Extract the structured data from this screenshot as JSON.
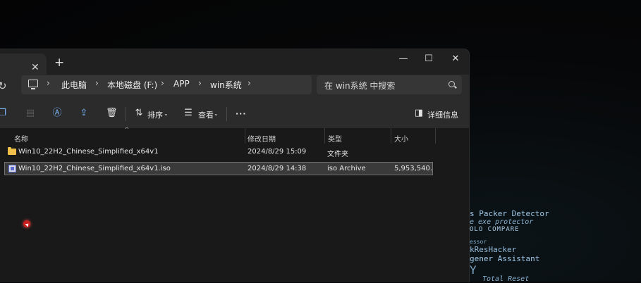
{
  "window": {
    "controls": {
      "minimize": "—",
      "maximize": "☐",
      "close": "✕"
    },
    "tab_close": "✕",
    "new_tab": "+"
  },
  "breadcrumb": [
    "此电脑",
    "本地磁盘 (F:)",
    "APP",
    "win系统"
  ],
  "search": {
    "placeholder": "在 win系统 中搜索"
  },
  "toolbar": {
    "sort_label": "排序",
    "view_label": "查看",
    "more_label": "···",
    "details_label": "详细信息"
  },
  "columns": {
    "name": "名称",
    "modified": "修改日期",
    "type": "类型",
    "size": "大小"
  },
  "files": [
    {
      "name": "Win10_22H2_Chinese_Simplified_x64v1",
      "modified": "2024/8/29 15:09",
      "type": "文件夹",
      "size": "",
      "selected": false
    },
    {
      "name": "Win10_22H2_Chinese_Simplified_x64v1.iso",
      "modified": "2024/8/29 14:38",
      "type": "iso Archive",
      "size": "5,953,540...",
      "selected": true
    }
  ],
  "background_text": [
    "s Packer Detector",
    "e exe protector",
    "OLO COMPARE",
    "essor",
    "kResHacker",
    "gener Assistant",
    "Y",
    "Total Reset"
  ],
  "colors": {
    "accent": "#7fb8ff",
    "folder": "#f0c04a",
    "selection": "#3a3a3a"
  }
}
